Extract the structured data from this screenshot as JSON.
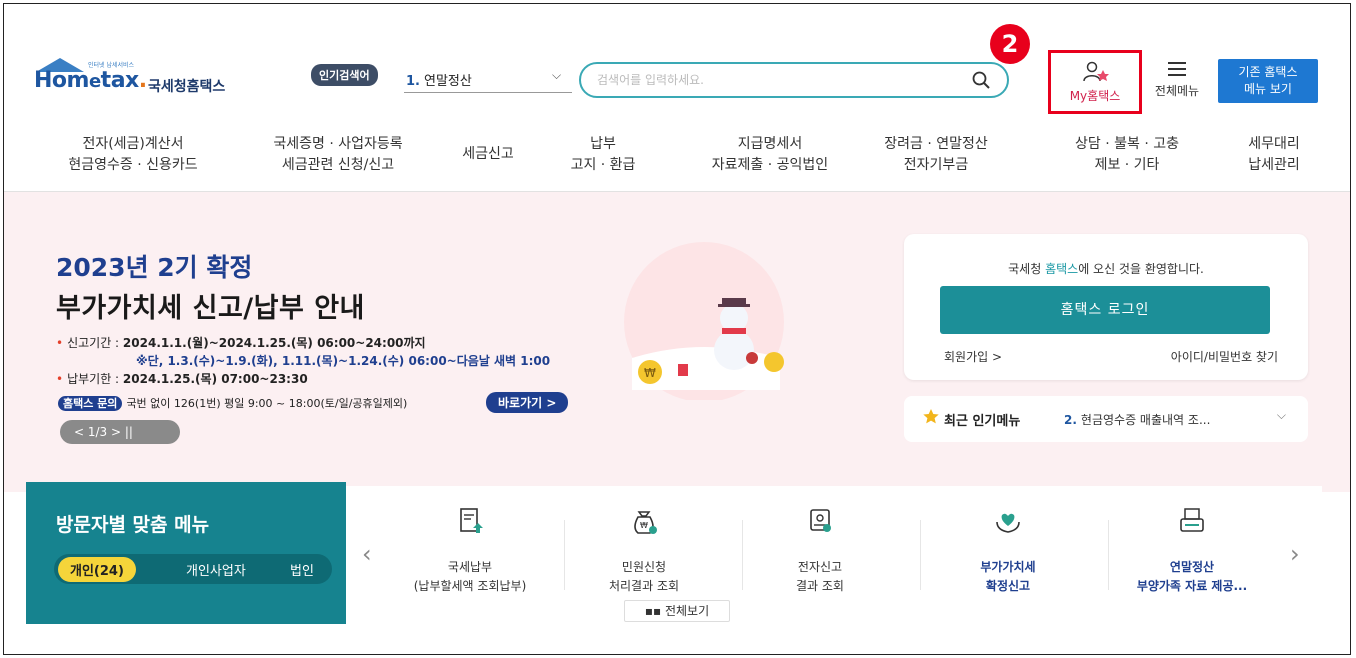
{
  "header": {
    "logo_small": "인터넷 납세서비스",
    "logo_word_prefix": "Hom",
    "logo_word_e": "e",
    "logo_word_suffix": "tax",
    "logo_dot": ".",
    "logo_name": "국세청홈택스",
    "popular_badge": "인기검색어",
    "popular_num": "1.",
    "popular_item": "연말정산",
    "search_placeholder": "검색어를 입력하세요.",
    "step_badge": "2",
    "my_hometax": "My홈택스",
    "all_menu": "전체메뉴",
    "old_hometax_line1": "기존 홈택스",
    "old_hometax_line2": "메뉴 보기"
  },
  "nav": [
    {
      "line1": "전자(세금)계산서",
      "line2": "현금영수증 · 신용카드"
    },
    {
      "line1": "국세증명 · 사업자등록",
      "line2": "세금관련 신청/신고"
    },
    {
      "line1": "세금신고",
      "line2": ""
    },
    {
      "line1": "납부",
      "line2": "고지 · 환급"
    },
    {
      "line1": "지급명세서",
      "line2": "자료제출 · 공익법인"
    },
    {
      "line1": "장려금 · 연말정산",
      "line2": "전자기부금"
    },
    {
      "line1": "상담 · 불복 · 고충",
      "line2": "제보 · 기타"
    },
    {
      "line1": "세무대리",
      "line2": "납세관리"
    }
  ],
  "hero": {
    "title1": "2023년 2기 확정",
    "title2": "부가가치세 신고/납부 안내",
    "period_label": "신고기간 : ",
    "period_value": "2024.1.1.(월)~2024.1.25.(목) 06:00~24:00까지",
    "period_note": "※단, 1.3.(수)~1.9.(화), 1.11.(목)~1.24.(수) 06:00~다음날 새벽 1:00",
    "due_label": "납부기한 : ",
    "due_value": "2024.1.25.(목) 07:00~23:30",
    "inquiry_tag": "홈택스 문의",
    "inquiry_text": "국번 없이 126(1번) 평일 9:00 ~ 18:00(토/일/공휴일제외)",
    "go_button": "바로가기 >",
    "pager": "<  1/3  >  ||"
  },
  "login": {
    "welcome_prefix": "국세청 ",
    "welcome_highlight": "홈택스",
    "welcome_suffix": "에 오신 것을 환영합니다.",
    "login_button": "홈택스 로그인",
    "join": "회원가입 >",
    "find": "아이디/비밀번호 찾기"
  },
  "recent_popular": {
    "title": "최근 인기메뉴",
    "num": "2.",
    "item": "현금영수증 매출내역 조..."
  },
  "visitor": {
    "title": "방문자별 맞춤 메뉴",
    "tabs": [
      "개인(24)",
      "개인사업자",
      "법인"
    ]
  },
  "quick_menu": [
    {
      "line1": "국세납부",
      "line2": "(납부할세액 조회납부)",
      "icon": "document-upload-icon"
    },
    {
      "line1": "민원신청",
      "line2": "처리결과 조회",
      "icon": "money-bag-icon"
    },
    {
      "line1": "전자신고",
      "line2": "결과 조회",
      "icon": "certificate-icon"
    },
    {
      "line1": "부가가치세",
      "line2": "확정신고",
      "icon": "heart-hands-icon"
    },
    {
      "line1": "연말정산",
      "line2": "부양가족 자료 제공...",
      "icon": "printer-doc-icon"
    }
  ],
  "quick_all": "전체보기",
  "colors": {
    "teal": "#16838f",
    "login_teal": "#1c8f98",
    "blue": "#1e78d2",
    "red": "#e8001c",
    "hero_bg": "#fcf0f2"
  }
}
